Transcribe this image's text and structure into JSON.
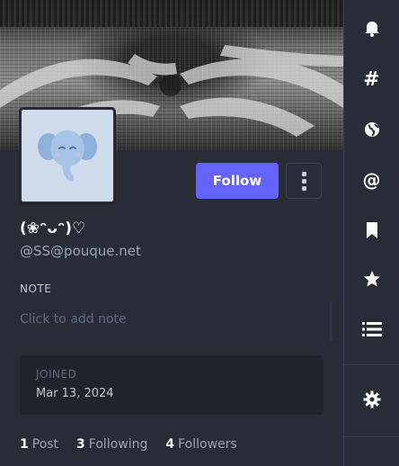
{
  "profile": {
    "display_name": "(❀ᵔᴗᵔ)♡",
    "handle": "@SS@pouque.net",
    "follow_label": "Follow",
    "note": {
      "label": "NOTE",
      "placeholder": "Click to add note"
    },
    "joined": {
      "label": "JOINED",
      "date": "Mar 13, 2024"
    },
    "counts": {
      "posts": {
        "value": "1",
        "label": "Post"
      },
      "following": {
        "value": "3",
        "label": "Following"
      },
      "followers": {
        "value": "4",
        "label": "Followers"
      }
    }
  },
  "nav": {
    "items": [
      {
        "name": "notifications",
        "icon": "bell-icon"
      },
      {
        "name": "explore",
        "icon": "hashtag-icon"
      },
      {
        "name": "federated",
        "icon": "globe-icon"
      },
      {
        "name": "mentions",
        "icon": "at-icon"
      },
      {
        "name": "bookmarks",
        "icon": "bookmark-icon"
      },
      {
        "name": "favourites",
        "icon": "star-icon"
      },
      {
        "name": "lists",
        "icon": "list-icon"
      },
      {
        "name": "preferences",
        "icon": "gear-icon"
      }
    ]
  },
  "colors": {
    "background": "#282c37",
    "accent": "#6364ff",
    "muted_text": "#9aa6b4",
    "panel": "#1f232b"
  }
}
